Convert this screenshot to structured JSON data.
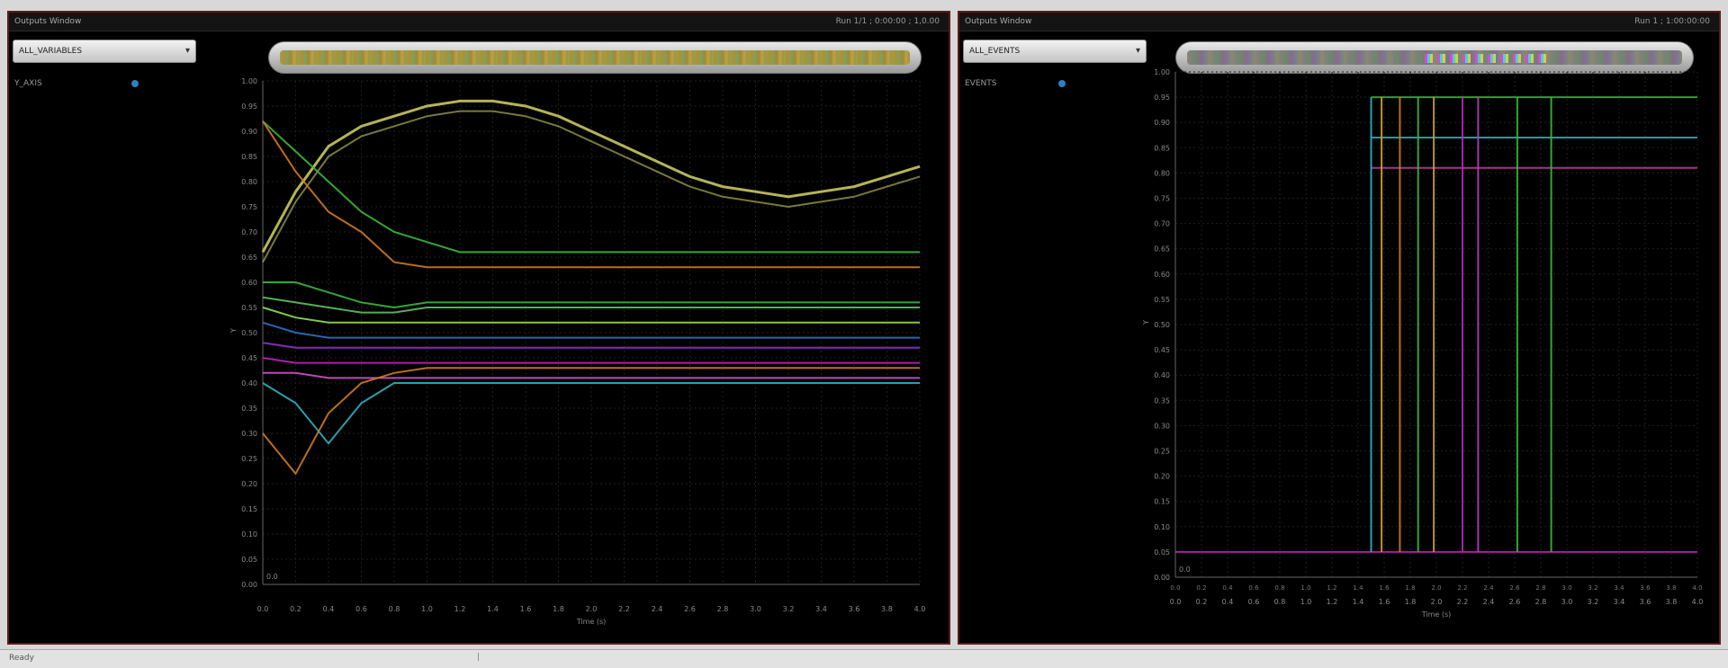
{
  "left_panel": {
    "title": "Outputs Window",
    "status": "Run 1/1 ; 0:00:00 ; 1,0.00",
    "selector_text": "ALL_VARIABLES",
    "sidebar_label": "Y_AXIS",
    "y_label": "Y",
    "x_label": "Time (s)",
    "y_ticks": [
      "1.00",
      "0.95",
      "0.90",
      "0.85",
      "0.80",
      "0.75",
      "0.70",
      "0.65",
      "0.60",
      "0.55",
      "0.50",
      "0.45",
      "0.40",
      "0.35",
      "0.30",
      "0.25",
      "0.20",
      "0.15",
      "0.10",
      "0.05",
      "0.00"
    ],
    "x_ticks": [
      "0.0",
      "0.2",
      "0.4",
      "0.6",
      "0.8",
      "1.0",
      "1.2",
      "1.4",
      "1.6",
      "1.8",
      "2.0",
      "2.2",
      "2.4",
      "2.6",
      "2.8",
      "3.0",
      "3.2",
      "3.4",
      "3.6",
      "3.8",
      "4.0"
    ],
    "zero_label": "0.0"
  },
  "right_panel": {
    "title": "Outputs Window",
    "status": "Run 1 ; 1:00:00:00",
    "selector_text": "ALL_EVENTS",
    "sidebar_label": "EVENTS",
    "y_label": "Y",
    "x_label": "Time (s)",
    "y_ticks": [
      "1.00",
      "0.95",
      "0.90",
      "0.85",
      "0.80",
      "0.75",
      "0.70",
      "0.65",
      "0.60",
      "0.55",
      "0.50",
      "0.45",
      "0.40",
      "0.35",
      "0.30",
      "0.25",
      "0.20",
      "0.15",
      "0.10",
      "0.05",
      "0.00"
    ],
    "x_ticks": [
      "0.0",
      "0.2",
      "0.4",
      "0.6",
      "0.8",
      "1.0",
      "1.2",
      "1.4",
      "1.6",
      "1.8",
      "2.0",
      "2.2",
      "2.4",
      "2.6",
      "2.8",
      "3.0",
      "3.2",
      "3.4",
      "3.6",
      "3.8",
      "4.0"
    ],
    "x_ticks_top": [
      "0.0",
      "0.2",
      "0.4",
      "0.6",
      "0.8",
      "1.0",
      "1.2",
      "1.4",
      "1.6",
      "1.8",
      "2.0",
      "2.2",
      "2.4",
      "2.6",
      "2.8",
      "3.0",
      "3.2",
      "3.4",
      "3.6",
      "3.8",
      "4.0"
    ],
    "zero_label": "0.0"
  },
  "footer": {
    "left_text": "Ready",
    "mark": "|"
  },
  "colors": {
    "panel_border": "#5a1c1c",
    "plot_bg": "#000000",
    "grid": "#1f1f1f",
    "yellow_curve": "#c8c860",
    "green": "#3ab83a",
    "orange": "#d07a20",
    "magenta": "#c020c0",
    "cyan": "#30b0c0",
    "lime": "#90e050"
  },
  "chart_data": [
    {
      "type": "line",
      "x": [
        0.0,
        0.2,
        0.4,
        0.6,
        0.8,
        1.0,
        1.2,
        1.4,
        1.6,
        1.8,
        2.0,
        2.2,
        2.4,
        2.6,
        2.8,
        3.0,
        3.2,
        3.4,
        3.6,
        3.8,
        4.0
      ],
      "series": [
        {
          "values": [
            0.66,
            0.78,
            0.87,
            0.91,
            0.93,
            0.95,
            0.96,
            0.96,
            0.95,
            0.93,
            0.9,
            0.87,
            0.84,
            0.81,
            0.79,
            0.78,
            0.77,
            0.78,
            0.79,
            0.81,
            0.83
          ]
        },
        {
          "values": [
            0.92,
            0.86,
            0.8,
            0.74,
            0.7,
            0.68,
            0.66,
            0.66,
            0.66,
            0.66,
            0.66,
            0.66,
            0.66,
            0.66,
            0.66,
            0.66,
            0.66,
            0.66,
            0.66,
            0.66,
            0.66
          ]
        },
        {
          "values": [
            0.92,
            0.82,
            0.74,
            0.7,
            0.64,
            0.63,
            0.63,
            0.63,
            0.63,
            0.63,
            0.63,
            0.63,
            0.63,
            0.63,
            0.63,
            0.63,
            0.63,
            0.63,
            0.63,
            0.63,
            0.63
          ]
        },
        {
          "values": [
            0.6,
            0.6,
            0.58,
            0.56,
            0.55,
            0.56,
            0.56,
            0.56,
            0.56,
            0.56,
            0.56,
            0.56,
            0.56,
            0.56,
            0.56,
            0.56,
            0.56,
            0.56,
            0.56,
            0.56,
            0.56
          ]
        },
        {
          "values": [
            0.57,
            0.56,
            0.55,
            0.54,
            0.54,
            0.55,
            0.55,
            0.55,
            0.55,
            0.55,
            0.55,
            0.55,
            0.55,
            0.55,
            0.55,
            0.55,
            0.55,
            0.55,
            0.55,
            0.55,
            0.55
          ]
        },
        {
          "values": [
            0.55,
            0.53,
            0.52,
            0.52,
            0.52,
            0.52,
            0.52,
            0.52,
            0.52,
            0.52,
            0.52,
            0.52,
            0.52,
            0.52,
            0.52,
            0.52,
            0.52,
            0.52,
            0.52,
            0.52,
            0.52
          ]
        },
        {
          "values": [
            0.52,
            0.5,
            0.49,
            0.49,
            0.49,
            0.49,
            0.49,
            0.49,
            0.49,
            0.49,
            0.49,
            0.49,
            0.49,
            0.49,
            0.49,
            0.49,
            0.49,
            0.49,
            0.49,
            0.49,
            0.49
          ]
        },
        {
          "values": [
            0.48,
            0.47,
            0.47,
            0.47,
            0.47,
            0.47,
            0.47,
            0.47,
            0.47,
            0.47,
            0.47,
            0.47,
            0.47,
            0.47,
            0.47,
            0.47,
            0.47,
            0.47,
            0.47,
            0.47,
            0.47
          ]
        },
        {
          "values": [
            0.45,
            0.44,
            0.44,
            0.44,
            0.44,
            0.44,
            0.44,
            0.44,
            0.44,
            0.44,
            0.44,
            0.44,
            0.44,
            0.44,
            0.44,
            0.44,
            0.44,
            0.44,
            0.44,
            0.44,
            0.44
          ]
        },
        {
          "values": [
            0.42,
            0.42,
            0.41,
            0.41,
            0.41,
            0.41,
            0.41,
            0.41,
            0.41,
            0.41,
            0.41,
            0.41,
            0.41,
            0.41,
            0.41,
            0.41,
            0.41,
            0.41,
            0.41,
            0.41,
            0.41
          ]
        },
        {
          "values": [
            0.4,
            0.36,
            0.28,
            0.36,
            0.4,
            0.4,
            0.4,
            0.4,
            0.4,
            0.4,
            0.4,
            0.4,
            0.4,
            0.4,
            0.4,
            0.4,
            0.4,
            0.4,
            0.4,
            0.4,
            0.4
          ]
        },
        {
          "values": [
            0.3,
            0.22,
            0.34,
            0.4,
            0.42,
            0.43,
            0.43,
            0.43,
            0.43,
            0.43,
            0.43,
            0.43,
            0.43,
            0.43,
            0.43,
            0.43,
            0.43,
            0.43,
            0.43,
            0.43,
            0.43
          ]
        }
      ],
      "ylim": [
        0,
        1
      ],
      "xlim": [
        0,
        4
      ],
      "grid": true
    },
    {
      "type": "line",
      "xlim": [
        0,
        4
      ],
      "ylim": [
        0,
        1
      ],
      "grid": true,
      "vertical_markers": [
        1.5,
        1.58,
        1.72,
        1.86,
        1.98,
        2.2,
        2.32,
        2.62,
        2.88
      ],
      "horizontal_levels": [
        0.05,
        0.81,
        0.87,
        0.95
      ]
    }
  ]
}
